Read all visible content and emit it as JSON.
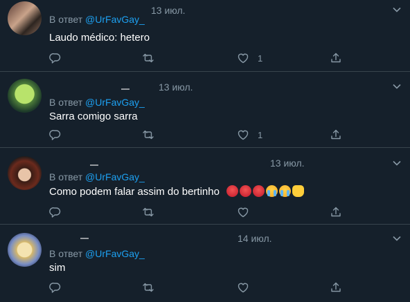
{
  "tweets": [
    {
      "reply_prefix": "В ответ",
      "reply_handle": "@UrFavGay_",
      "date": "13 июл.",
      "text": "Laudo médico: hetero",
      "likes": "1",
      "avatar": "avatar-photo"
    },
    {
      "reply_prefix": "В ответ",
      "reply_handle": "@UrFavGay_",
      "date": "13 июл.",
      "text": "Sarra comigo sarra",
      "likes": "1",
      "avatar": "avatar-green-character"
    },
    {
      "reply_prefix": "В ответ",
      "reply_handle": "@UrFavGay_",
      "date": "13 июл.",
      "text": "Como podem falar assim do bertinho",
      "emojis": [
        "angry-face",
        "angry-face",
        "angry-face",
        "crying-face",
        "crying-face",
        "fist"
      ],
      "likes": "",
      "avatar": "avatar-anime-character"
    },
    {
      "reply_prefix": "В ответ",
      "reply_handle": "@UrFavGay_",
      "date": "14 июл.",
      "text": "sim",
      "likes": "",
      "avatar": "avatar-drawn-character"
    }
  ],
  "icons": {
    "reply": "reply-icon",
    "retweet": "retweet-icon",
    "like": "heart-icon",
    "share": "share-icon",
    "more": "chevron-down-icon"
  },
  "colors": {
    "background": "#15202b",
    "link": "#1da1f2",
    "muted": "#8899a6",
    "divider": "#38444d"
  }
}
